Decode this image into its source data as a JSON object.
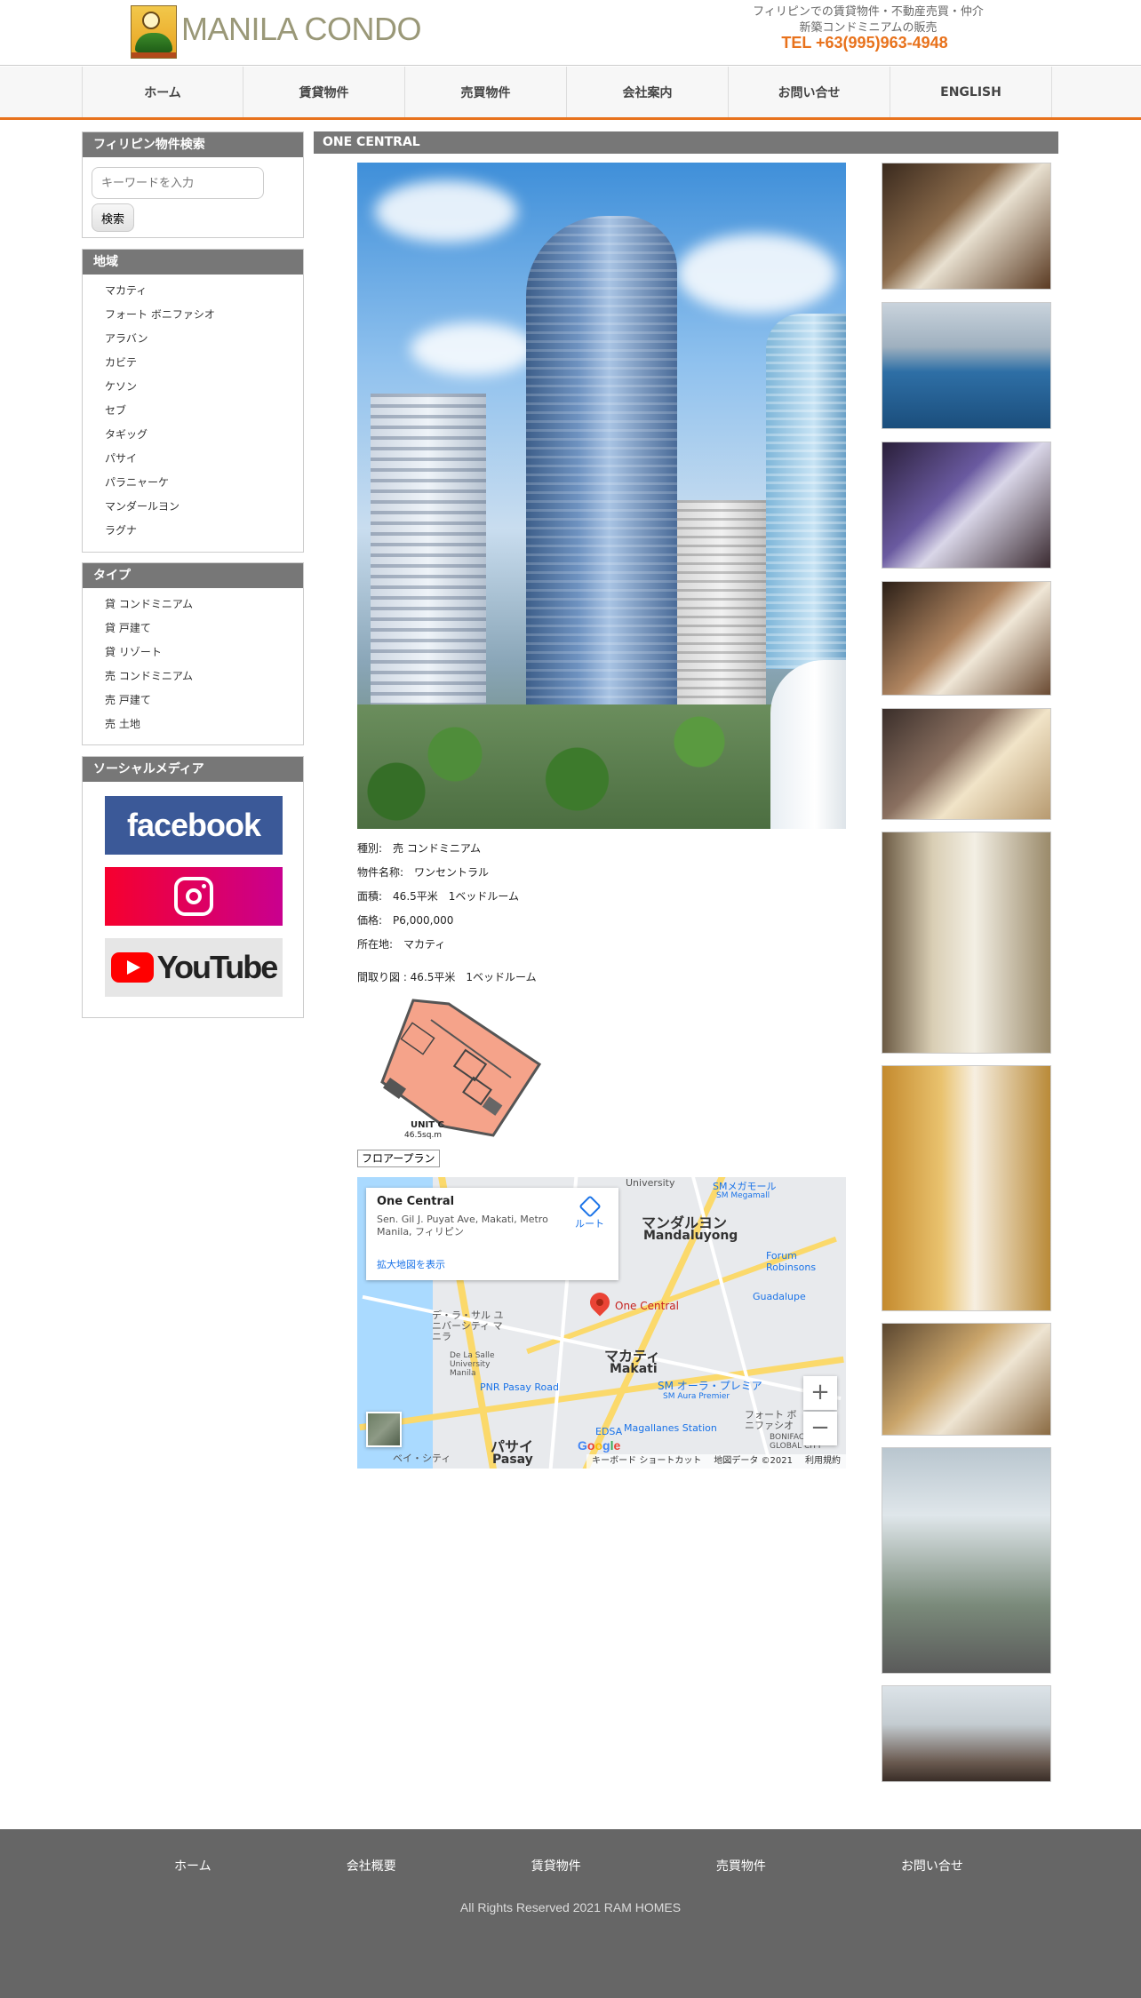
{
  "header": {
    "brand": "MANILA CONDO",
    "tagline_1": "フィリピンでの賃貸物件・不動産売買・仲介",
    "tagline_2": "新築コンドミニアムの販売",
    "tel": "TEL +63(995)963-4948",
    "accent_color": "#e8721c"
  },
  "nav": [
    "ホーム",
    "賃貸物件",
    "売買物件",
    "会社案内",
    "お問い合せ",
    "ENGLISH"
  ],
  "sidebar": {
    "search": {
      "title": "フィリピン物件検索",
      "placeholder": "キーワードを入力",
      "button": "検索"
    },
    "region": {
      "title": "地域",
      "items": [
        "マカティ",
        "フォート ボニファシオ",
        "アラバン",
        "カビテ",
        "ケソン",
        "セブ",
        "タギッグ",
        "パサイ",
        "パラニャーケ",
        "マンダールヨン",
        "ラグナ"
      ]
    },
    "type": {
      "title": "タイプ",
      "items": [
        "貸 コンドミニアム",
        "貸 戸建て",
        "貸 リゾート",
        "売 コンドミニアム",
        "売 戸建て",
        "売 土地"
      ]
    },
    "social": {
      "title": "ソーシャルメディア",
      "facebook": "facebook",
      "youtube": "YouTube"
    }
  },
  "property": {
    "title": "ONE CENTRAL",
    "details": [
      "種別:　売 コンドミニアム",
      "物件名称:　ワンセントラル",
      "面積:　46.5平米　1ベッドルーム",
      "価格:　P6,000,000",
      "所在地:　マカティ"
    ],
    "floorplan_caption": "間取り図 : 46.5平米　1ベッドルーム",
    "floorplan_unit": "UNIT C",
    "floorplan_size": "46.5sq.m",
    "floorplan_button": "フロアープラン"
  },
  "map": {
    "place": "One Central",
    "address": "Sen. Gil J. Puyat Ave, Makati, Metro Manila, フィリピン",
    "directions": "ルート",
    "larger_map": "拡大地図を表示",
    "labels": {
      "mandaluyong_jp": "マンダルヨン",
      "mandaluyong": "Mandaluyong",
      "makati_jp": "マカティ",
      "makati": "Makati",
      "pasay_jp": "パサイ",
      "pasay": "Pasay",
      "pin": "One Central",
      "pnr": "PNR Pasay Road",
      "edsa": "EDSA",
      "magallanes": "Magallanes Station",
      "sm_aura": "SM オーラ・プレミア",
      "sm_aura_en": "SM Aura Premier",
      "guadalupe": "Guadalupe",
      "forum": "Forum Robinsons",
      "sm_mega": "SMメガモール",
      "sm_megamall": "SM Megamall",
      "university": "University",
      "dlsu_jp": "デ・ラ・サル ユニバーシティ マニラ",
      "dlsu": "De La Salle University Manila",
      "bgc_jp": "フォート ボニファシオ",
      "bgc": "BONIFACIO GLOBAL CITY",
      "bay_city": "ベイ・シティ"
    },
    "footer": [
      "キーボード ショートカット",
      "地図データ ©2021",
      "利用規約"
    ],
    "zoom_in": "+",
    "zoom_out": "−"
  },
  "footer": {
    "links": [
      "ホーム",
      "会社概要",
      "賃貸物件",
      "売買物件",
      "お問い合せ"
    ],
    "copyright": "All Rights Reserved 2021 RAM HOMES"
  }
}
